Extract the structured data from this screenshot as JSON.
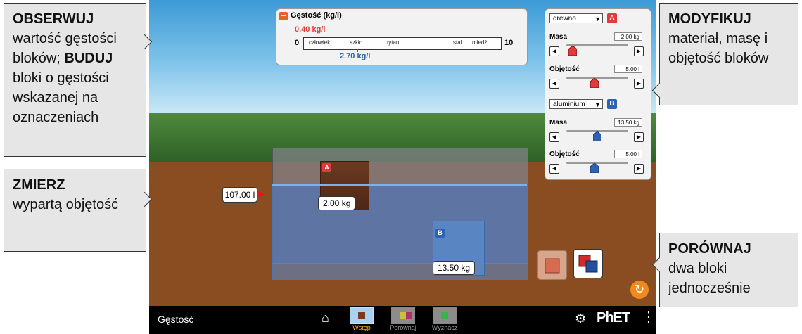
{
  "callouts": {
    "observe": {
      "title": "OBSERWUJ",
      "text1": "wartość gęstości bloków;",
      "build": "BUDUJ",
      "text2": "bloki o gęstości wskazanej na oznaczeniach"
    },
    "measure": {
      "title": "ZMIERZ",
      "text": "wypartą objętość"
    },
    "modify": {
      "title": "MODYFIKUJ",
      "text": "materiał, masę i objętość bloków"
    },
    "compare": {
      "title": "PORÓWNAJ",
      "text": "dwa bloki jednocześnie"
    }
  },
  "density_meter": {
    "title": "Gęstość (kg/l)",
    "min": "0",
    "max": "10",
    "ticks": [
      "człowiek",
      "szkło",
      "tytan",
      "stal",
      "miedź"
    ],
    "block_a_value": "0.40 kg/l",
    "block_b_value": "2.70 kg/l"
  },
  "controls": {
    "block_a": {
      "material": "drewno",
      "badge": "A",
      "mass_label": "Masa",
      "mass_value": "2.00 kg",
      "volume_label": "Objętość",
      "volume_value": "5.00 l"
    },
    "block_b": {
      "material": "aluminium",
      "badge": "B",
      "mass_label": "Masa",
      "mass_value": "13.50 kg",
      "volume_label": "Objętość",
      "volume_value": "5.00 l"
    }
  },
  "scene": {
    "volume_readout": "107.00 l",
    "block_a": {
      "badge": "A",
      "mass": "2.00 kg"
    },
    "block_b": {
      "badge": "B",
      "mass": "13.50 kg"
    }
  },
  "navbar": {
    "title": "Gęstość",
    "tabs": [
      "Wstęp",
      "Porównaj",
      "Wyznacz"
    ],
    "active_tab": "Wstęp",
    "logo": "PhET"
  },
  "colors": {
    "block_a": "#e23a3a",
    "block_b": "#2f63b2",
    "accent": "#f2c40e"
  }
}
